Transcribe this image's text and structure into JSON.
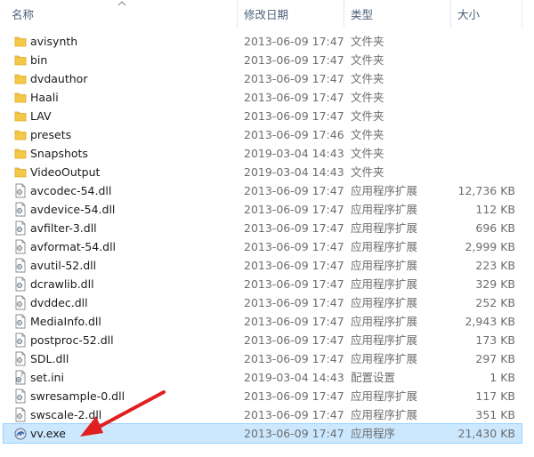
{
  "columns": {
    "name": "名称",
    "date": "修改日期",
    "type": "类型",
    "size": "大小"
  },
  "icons": {
    "folder": "folder-icon",
    "dll": "dll-file-icon",
    "ini": "settings-file-icon",
    "exe": "app-exe-icon",
    "sort": "sort-ascending-caret-icon",
    "annotation": "red-arrow-annotation"
  },
  "colors": {
    "folder": "#f5c948",
    "selection_bg": "#cce8ff",
    "selection_border": "#99d1ff",
    "arrow": "#e02020"
  },
  "files": [
    {
      "name": "avisynth",
      "date": "2013-06-09 17:47",
      "type": "文件夹",
      "size": "",
      "kind": "folder"
    },
    {
      "name": "bin",
      "date": "2013-06-09 17:47",
      "type": "文件夹",
      "size": "",
      "kind": "folder"
    },
    {
      "name": "dvdauthor",
      "date": "2013-06-09 17:47",
      "type": "文件夹",
      "size": "",
      "kind": "folder"
    },
    {
      "name": "Haali",
      "date": "2013-06-09 17:47",
      "type": "文件夹",
      "size": "",
      "kind": "folder"
    },
    {
      "name": "LAV",
      "date": "2013-06-09 17:47",
      "type": "文件夹",
      "size": "",
      "kind": "folder"
    },
    {
      "name": "presets",
      "date": "2013-06-09 17:46",
      "type": "文件夹",
      "size": "",
      "kind": "folder"
    },
    {
      "name": "Snapshots",
      "date": "2019-03-04 14:43",
      "type": "文件夹",
      "size": "",
      "kind": "folder"
    },
    {
      "name": "VideoOutput",
      "date": "2019-03-04 14:43",
      "type": "文件夹",
      "size": "",
      "kind": "folder"
    },
    {
      "name": "avcodec-54.dll",
      "date": "2013-06-09 17:47",
      "type": "应用程序扩展",
      "size": "12,736 KB",
      "kind": "dll"
    },
    {
      "name": "avdevice-54.dll",
      "date": "2013-06-09 17:47",
      "type": "应用程序扩展",
      "size": "112 KB",
      "kind": "dll"
    },
    {
      "name": "avfilter-3.dll",
      "date": "2013-06-09 17:47",
      "type": "应用程序扩展",
      "size": "696 KB",
      "kind": "dll"
    },
    {
      "name": "avformat-54.dll",
      "date": "2013-06-09 17:47",
      "type": "应用程序扩展",
      "size": "2,999 KB",
      "kind": "dll"
    },
    {
      "name": "avutil-52.dll",
      "date": "2013-06-09 17:47",
      "type": "应用程序扩展",
      "size": "223 KB",
      "kind": "dll"
    },
    {
      "name": "dcrawlib.dll",
      "date": "2013-06-09 17:47",
      "type": "应用程序扩展",
      "size": "329 KB",
      "kind": "dll"
    },
    {
      "name": "dvddec.dll",
      "date": "2013-06-09 17:47",
      "type": "应用程序扩展",
      "size": "252 KB",
      "kind": "dll"
    },
    {
      "name": "MediaInfo.dll",
      "date": "2013-06-09 17:47",
      "type": "应用程序扩展",
      "size": "2,943 KB",
      "kind": "dll"
    },
    {
      "name": "postproc-52.dll",
      "date": "2013-06-09 17:47",
      "type": "应用程序扩展",
      "size": "173 KB",
      "kind": "dll"
    },
    {
      "name": "SDL.dll",
      "date": "2013-06-09 17:47",
      "type": "应用程序扩展",
      "size": "297 KB",
      "kind": "dll"
    },
    {
      "name": "set.ini",
      "date": "2019-03-04 14:43",
      "type": "配置设置",
      "size": "1 KB",
      "kind": "ini"
    },
    {
      "name": "swresample-0.dll",
      "date": "2013-06-09 17:47",
      "type": "应用程序扩展",
      "size": "117 KB",
      "kind": "dll"
    },
    {
      "name": "swscale-2.dll",
      "date": "2013-06-09 17:47",
      "type": "应用程序扩展",
      "size": "351 KB",
      "kind": "dll"
    },
    {
      "name": "vv.exe",
      "date": "2013-06-09 17:47",
      "type": "应用程序",
      "size": "21,430 KB",
      "kind": "exe",
      "selected": true
    }
  ]
}
